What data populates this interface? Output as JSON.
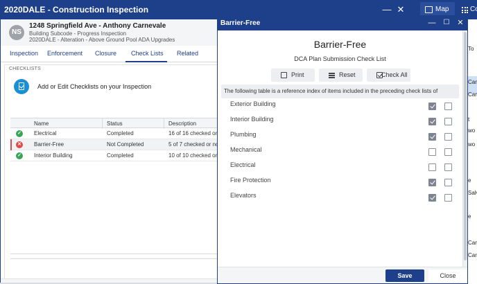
{
  "app": {
    "title": "2020DALE - Construction Inspection",
    "map_label": "Map",
    "co_label": "Co"
  },
  "bg_list": [
    "To",
    "Car",
    "Car",
    "t",
    "wo",
    "wo",
    "e",
    "Salv",
    "e",
    "Car",
    "Car"
  ],
  "inspection": {
    "initials": "NS",
    "address": "1248 Springfield Ave - Anthony Carnevale",
    "subcode": "Building Subcode - Progress Inspection",
    "description": "2020DALE - Alteration - Above Ground Pool ADA Upgrades",
    "tabs": [
      "Inspection",
      "Enforcement",
      "Closure",
      "Check Lists",
      "Related"
    ],
    "active_tab": "Check Lists",
    "section_label": "CHECKLISTS",
    "add_text": "Add or Edit Checklists on your Inspection",
    "table": {
      "columns": [
        "Name",
        "Status",
        "Description"
      ],
      "rows": [
        {
          "name": "Electrical",
          "status": "Completed",
          "description": "16 of 16 checked on",
          "state": "ok"
        },
        {
          "name": "Barrier-Free",
          "status": "Not Completed",
          "description": "5 of 7 checked or no",
          "state": "bad"
        },
        {
          "name": "Interior Building",
          "status": "Completed",
          "description": "10 of 10 checked on",
          "state": "ok"
        }
      ]
    }
  },
  "modal": {
    "window_title": "Barrier-Free",
    "heading": "Barrier-Free",
    "subheading": "DCA Plan Submission Check List",
    "buttons": {
      "print": "Print",
      "reset": "Reset",
      "check_all": "Check All"
    },
    "description": "The following table is a reference index of items included in the preceding check lists of",
    "items": [
      {
        "name": "Exterior Building",
        "col1": true,
        "col2": false
      },
      {
        "name": "Interior Building",
        "col1": true,
        "col2": false
      },
      {
        "name": "Plumbing",
        "col1": true,
        "col2": false
      },
      {
        "name": "Mechanical",
        "col1": false,
        "col2": false
      },
      {
        "name": "Electrical",
        "col1": false,
        "col2": false
      },
      {
        "name": "Fire Protection",
        "col1": true,
        "col2": false
      },
      {
        "name": "Elevators",
        "col1": true,
        "col2": false
      }
    ],
    "footer": {
      "save": "Save",
      "close": "Close"
    }
  },
  "colors": {
    "brand": "#1e3f8a",
    "ok": "#3aa655",
    "error": "#e04a4a",
    "accent": "#1a8fd6"
  }
}
